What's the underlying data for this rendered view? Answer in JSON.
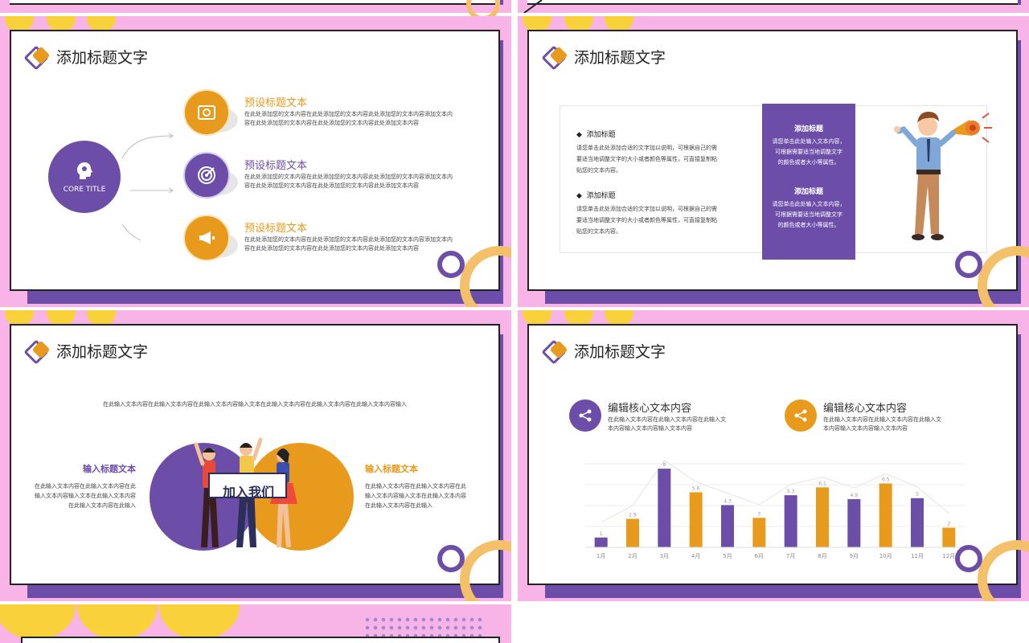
{
  "slide_title": "添加标题文字",
  "slide1": {
    "core_label": "CORE TITLE",
    "items": [
      {
        "title": "预设标题文本",
        "desc1": "在此处添加您的文本内容在此处添加您的文本内容此处添加您的文本内容添加文本内",
        "desc2": "容在此处添加您的文本内容在此处添加您的文本内容此处添加文本内容",
        "color": "#e89a1c",
        "icon": "image-frame-icon"
      },
      {
        "title": "预设标题文本",
        "desc1": "在此处添加您的文本内容在此处添加您的文本内容此处添加您的文本内容添加文本内",
        "desc2": "容在此处添加您的文本内容在此处添加您的文本内容此处添加文本内容",
        "color": "#6c4ea8",
        "icon": "target-icon"
      },
      {
        "title": "预设标题文本",
        "desc1": "在此处添加您的文本内容在此处添加您的文本内容此处添加您的文本内容添加文本内",
        "desc2": "容在此处添加您的文本内容在此处添加您的文本内容此处添加文本内容",
        "color": "#e89a1c",
        "icon": "megaphone-icon"
      }
    ]
  },
  "slide2": {
    "blocks": [
      {
        "title": "添加标题",
        "lines": [
          "请您单击此处添加合适的文字加以说明，可根据自己的需",
          "要适当地调整文字的大小或者颜色等属性，可直接复制粘",
          "贴您的文本内容。"
        ]
      },
      {
        "title": "添加标题",
        "lines": [
          "请您单击此处添加合适的文字加以说明，可根据自己的需",
          "要适当地调整文字的大小或者颜色等属性，可直接复制粘",
          "贴您的文本内容。"
        ]
      }
    ],
    "purple_blocks": [
      {
        "title": "添加标题",
        "lines": [
          "请您单击此处输入文本内容，",
          "可根据需要适当地调整文字",
          "的颜色或者大小等属性。"
        ]
      },
      {
        "title": "添加标题",
        "lines": [
          "请您单击此处输入文本内容，",
          "可根据需要适当地调整文字",
          "的颜色或者大小等属性。"
        ]
      }
    ]
  },
  "slide3": {
    "top_text": "在此输入文本内容在此输入文本内容在此输入文本内容输入文本在此输入文本内容在此输入文本内容在此输入文本内容输入",
    "left_title": "输入标题文本",
    "left_lines": [
      "在此输入文本内容在此输入文本内容在此",
      "输入文本内容输入文本在此输入文本内容",
      "在此输入文本内容在此输入"
    ],
    "right_title": "输入标题文本",
    "right_lines": [
      "在此输入文本内容在此输入文本内容在此",
      "输入文本内容输入文本在此输入文本内容",
      "在此输入文本内容在此输入"
    ],
    "sign_text": "加入我们"
  },
  "slide4": {
    "headers": [
      {
        "title": "编辑核心文本内容",
        "lines": [
          "在此输入文本内容在此输入文本内容在此输入文",
          "本内容输入文本内容输入文本内容"
        ],
        "color": "#6c4ea8"
      },
      {
        "title": "编辑核心文本内容",
        "lines": [
          "在此输入文本内容在此输入文本内容在此输入文",
          "本内容输入文本内容输入文本内容"
        ],
        "color": "#e89a1c"
      }
    ]
  },
  "chart_data": {
    "type": "bar",
    "categories": [
      "1月",
      "2月",
      "3月",
      "4月",
      "5月",
      "6月",
      "7月",
      "8月",
      "9月",
      "10月",
      "11月",
      "12月"
    ],
    "values": [
      1,
      2.9,
      8,
      5.6,
      4.3,
      3,
      5.3,
      6.1,
      4.9,
      6.5,
      5,
      2
    ],
    "value_labels": [
      "1",
      "2.9",
      "8",
      "5.6",
      "4.3",
      "3",
      "5.3",
      "6.1",
      "4.9",
      "6.5",
      "5",
      "2"
    ],
    "bar_colors": [
      "#6c4ea8",
      "#e89a1c"
    ],
    "ylim": [
      0,
      8.5
    ],
    "grid": true
  },
  "colors": {
    "pink": "#f8b4e6",
    "purple": "#6c4ea8",
    "orange": "#e89a1c",
    "yellow": "#f9d23b"
  }
}
